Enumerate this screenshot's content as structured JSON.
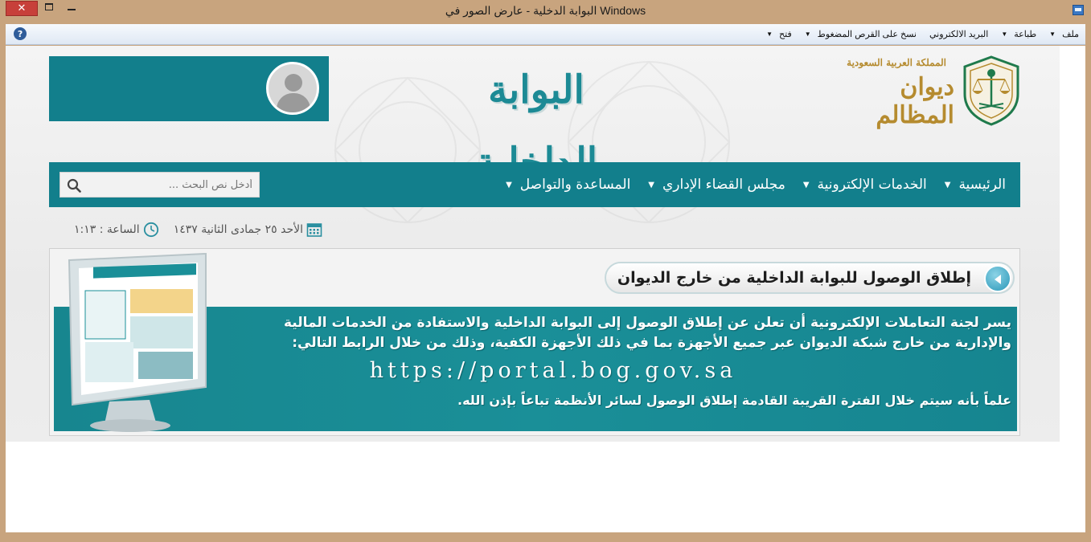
{
  "window": {
    "title": "البوابة الدخلية - عارض الصور في Windows",
    "close_glyph": "✕"
  },
  "menubar": {
    "items": [
      {
        "label": "ملف",
        "has_dropdown": true
      },
      {
        "label": "طباعة",
        "has_dropdown": true
      },
      {
        "label": "البريد الالكتروني",
        "has_dropdown": false
      },
      {
        "label": "نسخ على القرص المضغوط",
        "has_dropdown": true
      },
      {
        "label": "فتح",
        "has_dropdown": true
      }
    ],
    "dropdown_glyph": "▼",
    "help_glyph": "?"
  },
  "header": {
    "portal_title": "البوابة الداخلية",
    "diwan_small": "المملكة العربية السعودية",
    "diwan_name": "ديوان المظالم"
  },
  "nav": {
    "items": [
      {
        "label": "الرئيسية"
      },
      {
        "label": "الخدمات الإلكترونية"
      },
      {
        "label": "مجلس القضاء الإداري"
      },
      {
        "label": "المساعدة والتواصل"
      }
    ],
    "caret": "▼",
    "search_placeholder": "أدخل نص البحث ..."
  },
  "datebar": {
    "date": "الأحد ٢٥ جمادى الثانية ١٤٣٧",
    "time": "الساعة : ١:١٣"
  },
  "banner": {
    "heading": "إطلاق الوصول للبوابة الداخلية من خارج الديوان",
    "line1": "يسر لجنة التعاملات الإلكترونية أن تعلن عن إطلاق الوصول إلى البوابة الداخلية والاستفادة من الخدمات المالية",
    "line2": "والإدارية من خارج شبكة الديوان عبر جميع الأجهزة بما في ذلك الأجهزة الكفية، وذلك من خلال الرابط التالي:",
    "url": "https://portal.bog.gov.sa",
    "line3": "علماً بأنه سيتم خلال الفترة القريبة القادمة إطلاق الوصول لسائر الأنظمة تباعاً بإذن الله."
  },
  "colors": {
    "teal": "#127f8c",
    "gold": "#b58b2f",
    "frame": "#c8a47e"
  }
}
